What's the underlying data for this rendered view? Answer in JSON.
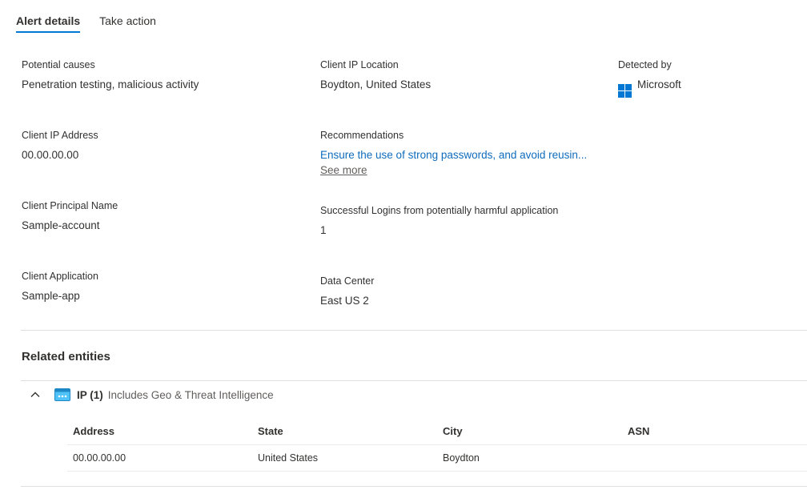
{
  "tabs": [
    {
      "label": "Alert details",
      "active": true
    },
    {
      "label": "Take action",
      "active": false
    }
  ],
  "details": {
    "potential_causes": {
      "label": "Potential causes",
      "value": "Penetration testing, malicious activity"
    },
    "client_ip_location": {
      "label": "Client IP Location",
      "value": "Boydton, United States"
    },
    "detected_by": {
      "label": "Detected by",
      "value": "Microsoft",
      "icon": "microsoft-logo-icon"
    },
    "client_ip_address": {
      "label": "Client IP Address",
      "value": "00.00.00.00"
    },
    "recommendations": {
      "label": "Recommendations",
      "value": "Ensure the use of strong passwords, and avoid reusin...",
      "see_more": "See more"
    },
    "client_principal_name": {
      "label": "Client Principal Name",
      "value": "Sample-account"
    },
    "successful_logins": {
      "label": "Successful Logins from potentially harmful application",
      "value": "1"
    },
    "client_application": {
      "label": "Client Application",
      "value": "Sample-app"
    },
    "data_center": {
      "label": "Data Center",
      "value": "East US 2"
    }
  },
  "related": {
    "title": "Related entities",
    "group": {
      "name": "IP (1)",
      "description": "Includes Geo & Threat Intelligence",
      "icon": "ip-address-icon",
      "expanded_icon": "chevron-up-icon"
    },
    "columns": [
      "Address",
      "State",
      "City",
      "ASN"
    ],
    "rows": [
      [
        "00.00.00.00",
        "United States",
        "Boydton",
        ""
      ]
    ]
  },
  "colors": {
    "accent": "#0078d4",
    "link": "#0f6cbd",
    "divider": "#e1dfdd",
    "ip_icon": "#4fc3f7"
  }
}
